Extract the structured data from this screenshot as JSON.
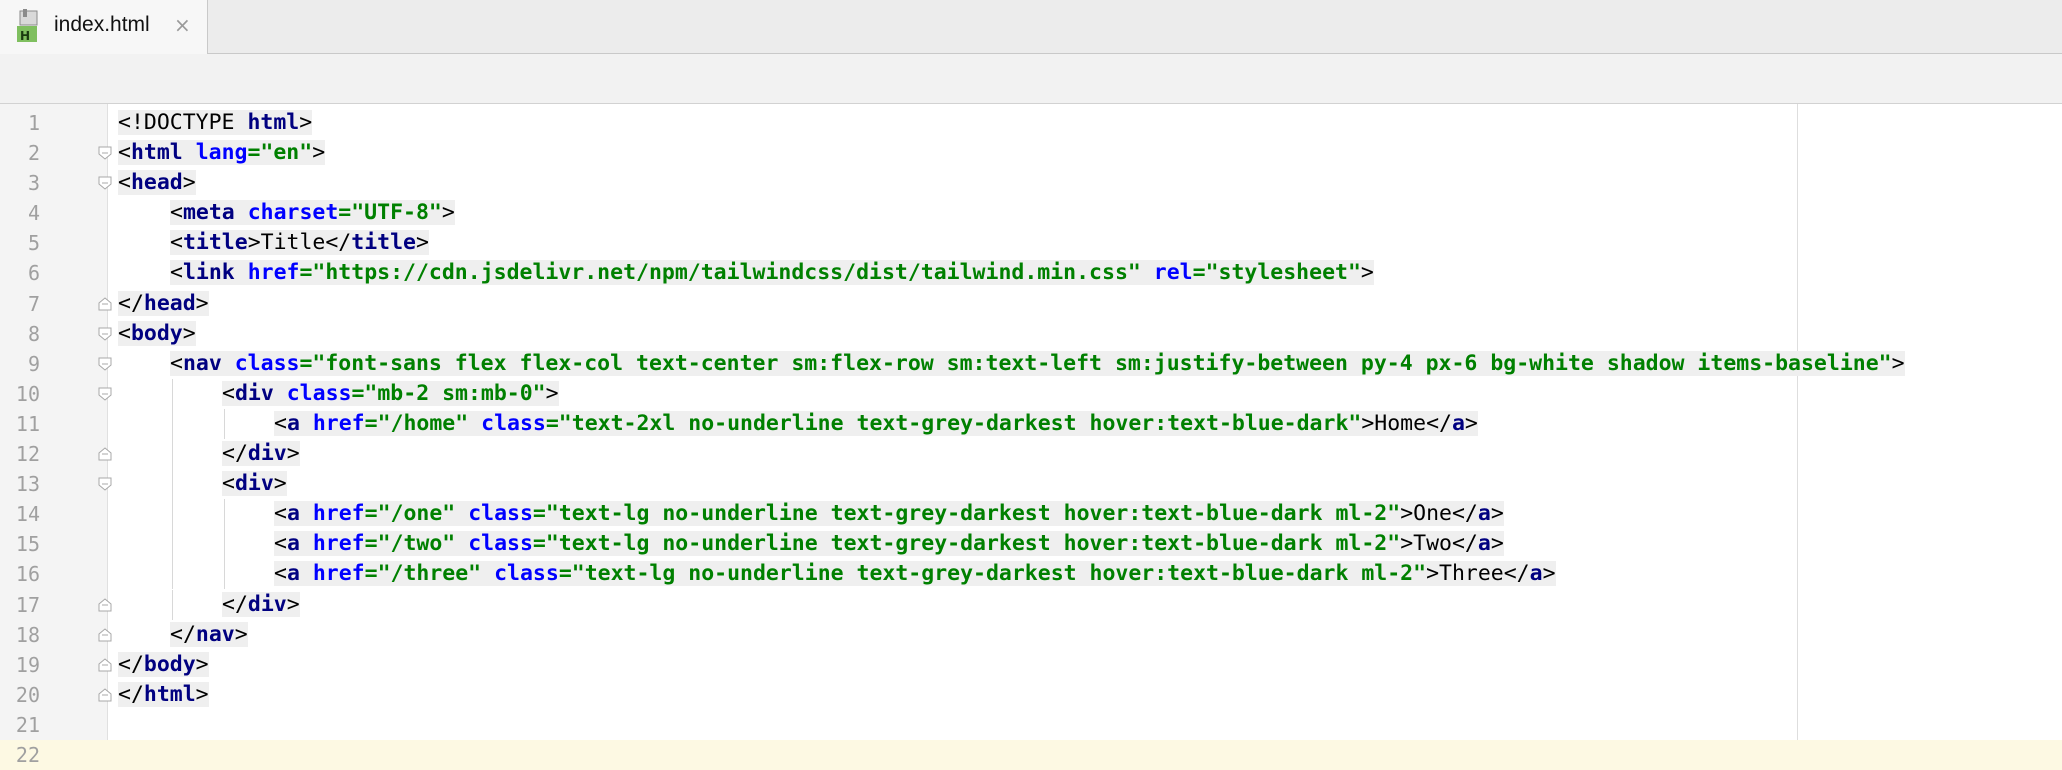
{
  "tab": {
    "filename": "index.html",
    "close_glyph": "×",
    "icon": "html-file-icon",
    "icon_badge": "H"
  },
  "editor": {
    "current_line": 22,
    "lines": [
      {
        "n": "1",
        "indent": 0,
        "fold": "none",
        "parts": [
          [
            "tx",
            "<!DOCTYPE "
          ],
          [
            "tg",
            "html"
          ],
          [
            "tx",
            ">"
          ]
        ]
      },
      {
        "n": "2",
        "indent": 0,
        "fold": "open",
        "parts": [
          [
            "tx",
            "<"
          ],
          [
            "tg",
            "html "
          ],
          [
            "at",
            "lang"
          ],
          [
            "vl",
            "=\"en\""
          ],
          [
            "tx",
            ">"
          ]
        ]
      },
      {
        "n": "3",
        "indent": 0,
        "fold": "open",
        "parts": [
          [
            "tx",
            "<"
          ],
          [
            "tg",
            "head"
          ],
          [
            "tx",
            ">"
          ]
        ]
      },
      {
        "n": "4",
        "indent": 4,
        "fold": "none",
        "parts": [
          [
            "tx",
            "<"
          ],
          [
            "tg",
            "meta "
          ],
          [
            "at",
            "charset"
          ],
          [
            "vl",
            "=\"UTF-8\""
          ],
          [
            "tx",
            ">"
          ]
        ]
      },
      {
        "n": "5",
        "indent": 4,
        "fold": "none",
        "parts": [
          [
            "tx",
            "<"
          ],
          [
            "tg",
            "title"
          ],
          [
            "tx",
            ">Title</"
          ],
          [
            "tg",
            "title"
          ],
          [
            "tx",
            ">"
          ]
        ]
      },
      {
        "n": "6",
        "indent": 4,
        "fold": "none",
        "parts": [
          [
            "tx",
            "<"
          ],
          [
            "tg",
            "link "
          ],
          [
            "at",
            "href"
          ],
          [
            "vl",
            "=\"https://cdn.jsdelivr.net/npm/tailwindcss/dist/tailwind.min.css\" "
          ],
          [
            "at",
            "rel"
          ],
          [
            "vl",
            "=\"stylesheet\""
          ],
          [
            "tx",
            ">"
          ]
        ]
      },
      {
        "n": "7",
        "indent": 0,
        "fold": "close",
        "parts": [
          [
            "tx",
            "</"
          ],
          [
            "tg",
            "head"
          ],
          [
            "tx",
            ">"
          ]
        ]
      },
      {
        "n": "8",
        "indent": 0,
        "fold": "open",
        "parts": [
          [
            "tx",
            "<"
          ],
          [
            "tg",
            "body"
          ],
          [
            "tx",
            ">"
          ]
        ]
      },
      {
        "n": "9",
        "indent": 4,
        "fold": "open",
        "parts": [
          [
            "tx",
            "<"
          ],
          [
            "tg",
            "nav "
          ],
          [
            "at",
            "class"
          ],
          [
            "vl",
            "=\"font-sans flex flex-col text-center sm:flex-row sm:text-left sm:justify-between py-4 px-6 bg-white shadow items-baseline\""
          ],
          [
            "tx",
            ">"
          ]
        ]
      },
      {
        "n": "10",
        "indent": 8,
        "fold": "open",
        "parts": [
          [
            "tx",
            "<"
          ],
          [
            "tg",
            "div "
          ],
          [
            "at",
            "class"
          ],
          [
            "vl",
            "=\"mb-2 sm:mb-0\""
          ],
          [
            "tx",
            ">"
          ]
        ]
      },
      {
        "n": "11",
        "indent": 12,
        "fold": "none",
        "parts": [
          [
            "tx",
            "<"
          ],
          [
            "tg",
            "a "
          ],
          [
            "at",
            "href"
          ],
          [
            "vl",
            "=\"/home\" "
          ],
          [
            "at",
            "class"
          ],
          [
            "vl",
            "=\"text-2xl no-underline text-grey-darkest hover:text-blue-dark\""
          ],
          [
            "tx",
            ">Home</"
          ],
          [
            "tg",
            "a"
          ],
          [
            "tx",
            ">"
          ]
        ]
      },
      {
        "n": "12",
        "indent": 8,
        "fold": "close",
        "parts": [
          [
            "tx",
            "</"
          ],
          [
            "tg",
            "div"
          ],
          [
            "tx",
            ">"
          ]
        ]
      },
      {
        "n": "13",
        "indent": 8,
        "fold": "open",
        "parts": [
          [
            "tx",
            "<"
          ],
          [
            "tg",
            "div"
          ],
          [
            "tx",
            ">"
          ]
        ]
      },
      {
        "n": "14",
        "indent": 12,
        "fold": "none",
        "parts": [
          [
            "tx",
            "<"
          ],
          [
            "tg",
            "a "
          ],
          [
            "at",
            "href"
          ],
          [
            "vl",
            "=\"/one\" "
          ],
          [
            "at",
            "class"
          ],
          [
            "vl",
            "=\"text-lg no-underline text-grey-darkest hover:text-blue-dark ml-2\""
          ],
          [
            "tx",
            ">One</"
          ],
          [
            "tg",
            "a"
          ],
          [
            "tx",
            ">"
          ]
        ]
      },
      {
        "n": "15",
        "indent": 12,
        "fold": "none",
        "parts": [
          [
            "tx",
            "<"
          ],
          [
            "tg",
            "a "
          ],
          [
            "at",
            "href"
          ],
          [
            "vl",
            "=\"/two\" "
          ],
          [
            "at",
            "class"
          ],
          [
            "vl",
            "=\"text-lg no-underline text-grey-darkest hover:text-blue-dark ml-2\""
          ],
          [
            "tx",
            ">Two</"
          ],
          [
            "tg",
            "a"
          ],
          [
            "tx",
            ">"
          ]
        ]
      },
      {
        "n": "16",
        "indent": 12,
        "fold": "none",
        "parts": [
          [
            "tx",
            "<"
          ],
          [
            "tg",
            "a "
          ],
          [
            "at",
            "href"
          ],
          [
            "vl",
            "=\"/three\" "
          ],
          [
            "at",
            "class"
          ],
          [
            "vl",
            "=\"text-lg no-underline text-grey-darkest hover:text-blue-dark ml-2\""
          ],
          [
            "tx",
            ">Three</"
          ],
          [
            "tg",
            "a"
          ],
          [
            "tx",
            ">"
          ]
        ]
      },
      {
        "n": "17",
        "indent": 8,
        "fold": "close",
        "parts": [
          [
            "tx",
            "</"
          ],
          [
            "tg",
            "div"
          ],
          [
            "tx",
            ">"
          ]
        ]
      },
      {
        "n": "18",
        "indent": 4,
        "fold": "close",
        "parts": [
          [
            "tx",
            "</"
          ],
          [
            "tg",
            "nav"
          ],
          [
            "tx",
            ">"
          ]
        ]
      },
      {
        "n": "19",
        "indent": 0,
        "fold": "close",
        "parts": [
          [
            "tx",
            "</"
          ],
          [
            "tg",
            "body"
          ],
          [
            "tx",
            ">"
          ]
        ]
      },
      {
        "n": "20",
        "indent": 0,
        "fold": "close",
        "parts": [
          [
            "tx",
            "</"
          ],
          [
            "tg",
            "html"
          ],
          [
            "tx",
            ">"
          ]
        ]
      },
      {
        "n": "21",
        "indent": 0,
        "fold": "none",
        "parts": []
      },
      {
        "n": "22",
        "indent": 0,
        "fold": "none",
        "parts": []
      }
    ]
  },
  "colors": {
    "tag": "#000080",
    "attribute": "#0000ff",
    "value": "#008000",
    "text": "#000000",
    "current_line": "#fdf9e3"
  }
}
